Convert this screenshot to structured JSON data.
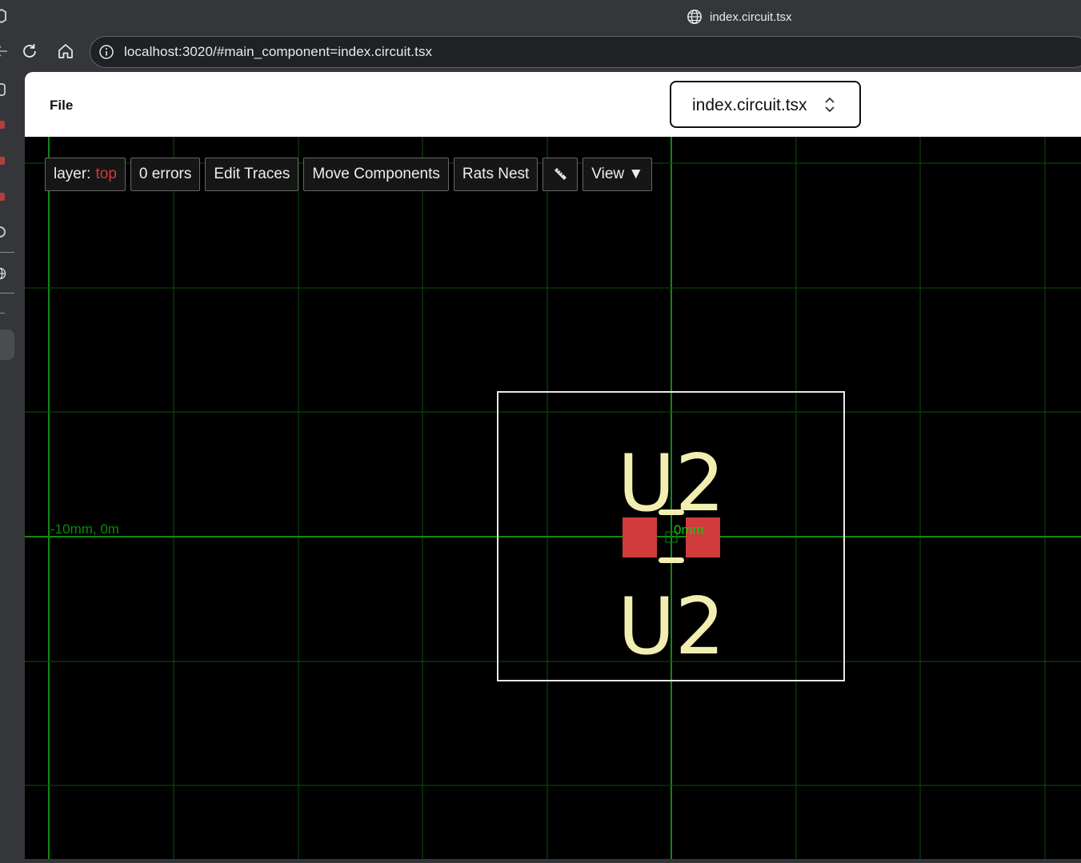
{
  "browser": {
    "tab_title": "index.circuit.tsx",
    "url": "localhost:3020/#main_component=index.circuit.tsx"
  },
  "menu": {
    "file_label": "File",
    "file_select_value": "index.circuit.tsx"
  },
  "toolbar": {
    "layer_label": "layer:",
    "layer_value": "top",
    "errors_label": "0 errors",
    "edit_traces_label": "Edit Traces",
    "move_components_label": "Move Components",
    "rats_nest_label": "Rats Nest",
    "measure_icon": "ruler-icon",
    "view_label": "View ▼"
  },
  "pcb": {
    "cursor_coordinate": "-10mm, 0m",
    "origin_label": "0mm",
    "component_label_top": "U2",
    "component_label_bottom": "U2",
    "colors": {
      "grid": "#0b4f0b",
      "axis": "#0e8a0e",
      "coordinate_text": "#0a8a0a",
      "silkscreen": "#f2eeb0",
      "pad": "#d13b3b",
      "board_outline": "#e8e8e8",
      "background": "#000000"
    }
  }
}
